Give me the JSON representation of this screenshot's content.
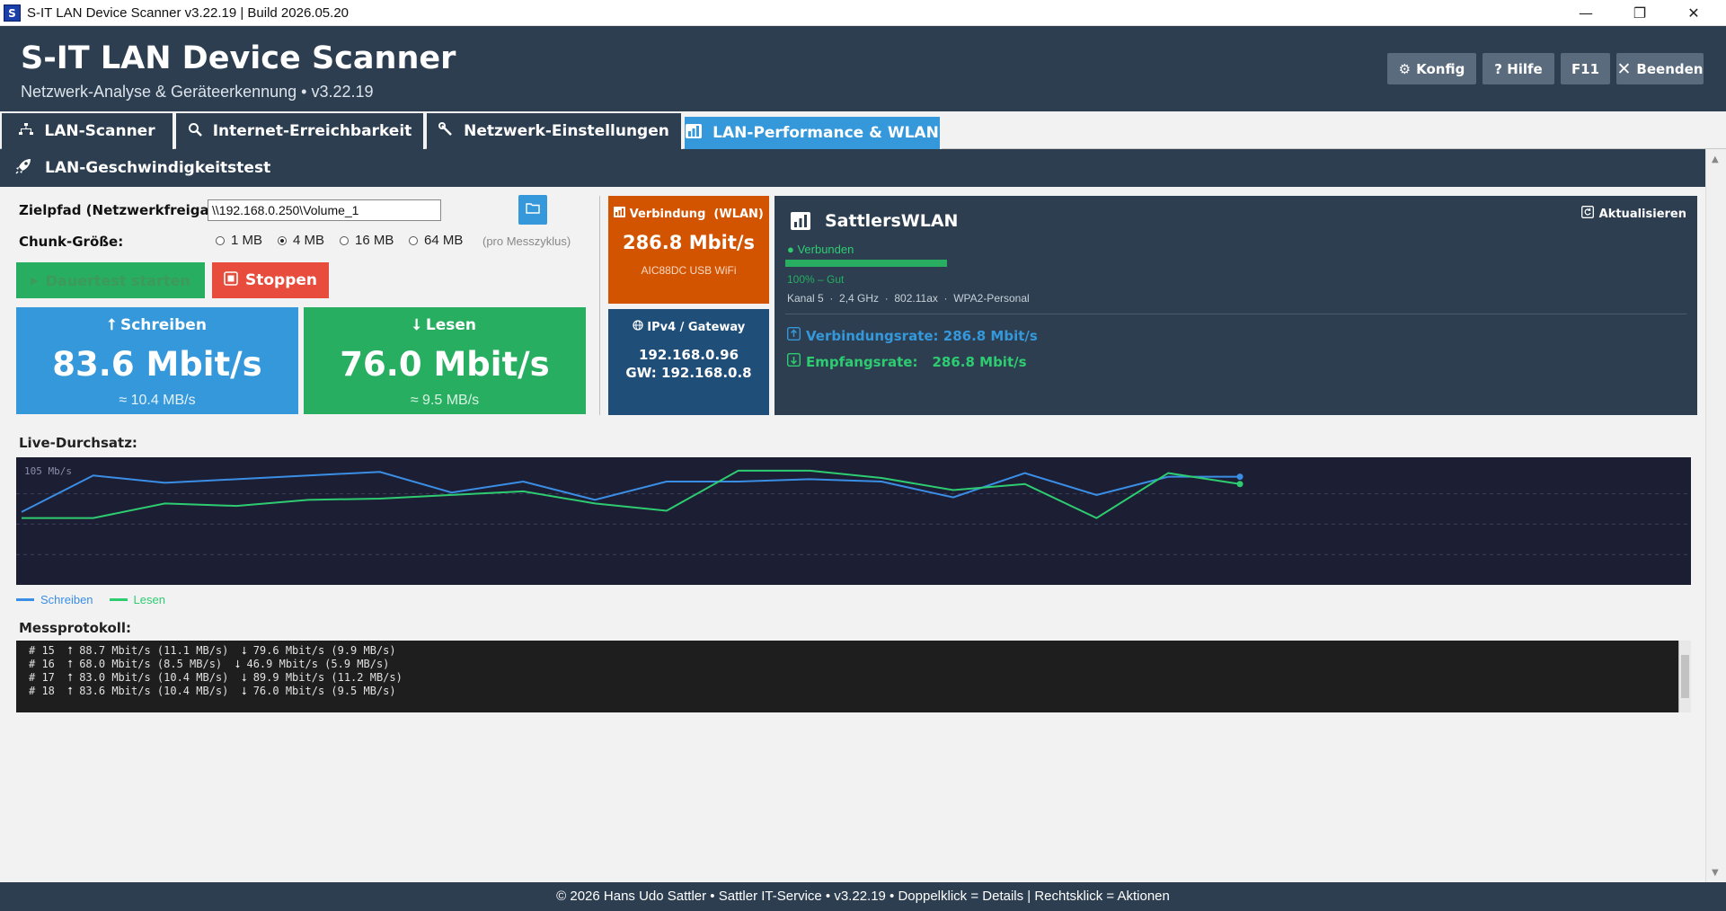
{
  "window": {
    "title": "S-IT LAN Device Scanner v3.22.19 | Build 2026.05.20",
    "icon_text": "S",
    "minimize": "—",
    "maximize": "❐",
    "close": "✕"
  },
  "header": {
    "title": "S-IT LAN Device Scanner",
    "subtitle": "Netzwerk-Analyse & Geräteerkennung  •  v3.22.19",
    "buttons": {
      "config": "Konfig",
      "help": "? Hilfe",
      "f11": "F11",
      "quit": "Beenden"
    }
  },
  "tabs": [
    {
      "label": "LAN-Scanner",
      "icon": "network-icon"
    },
    {
      "label": "Internet-Erreichbarkeit",
      "icon": "search-icon"
    },
    {
      "label": "Netzwerk-Einstellungen",
      "icon": "wrench-icon"
    },
    {
      "label": "LAN-Performance & WLAN",
      "icon": "chart-icon",
      "active": true
    }
  ],
  "section": {
    "title": "LAN-Geschwindigkeitstest",
    "icon": "rocket-icon"
  },
  "form": {
    "path_label": "Zielpfad (Netzwerkfreigabe):",
    "path_value": "\\\\192.168.0.250\\Volume_1",
    "chunk_label": "Chunk-Größe:",
    "chunk_options": [
      "1 MB",
      "4 MB",
      "16 MB",
      "64 MB"
    ],
    "chunk_selected": "4 MB",
    "chunk_hint": "(pro Messzyklus)",
    "start_label": "Dauertest starten",
    "stop_label": "Stoppen"
  },
  "write": {
    "label": "Schreiben",
    "value": "83.6 Mbit/s",
    "sub": "≈ 10.4 MB/s",
    "color": "#3498db"
  },
  "read": {
    "label": "Lesen",
    "value": "76.0 Mbit/s",
    "sub": "≈ 9.5 MB/s",
    "color": "#27ae60"
  },
  "connection": {
    "label": "Verbindung  (WLAN)",
    "value": "286.8 Mbit/s",
    "adapter": "AIC88DC USB WiFi"
  },
  "ip": {
    "label": "IPv4 / Gateway",
    "ip": "192.168.0.96",
    "gateway": "GW: 192.168.0.8"
  },
  "wlan": {
    "ssid": "SattlersWLAN",
    "refresh": "Aktualisieren",
    "status": "● Verbunden",
    "signal_percent": 100,
    "quality": "100%  –  Gut",
    "details": "Kanal 5  ·  2,4 GHz  ·  802.11ax  ·  WPA2-Personal",
    "link_rate_label": "Verbindungsrate: 286.8 Mbit/s",
    "rx_rate_label": "Empfangsrate:",
    "rx_rate_value": "286.8 Mbit/s",
    "accent_blue": "#3498db",
    "accent_green": "#2ecc71"
  },
  "chart_label": "Live-Durchsatz:",
  "chart_data": {
    "type": "line",
    "title": "",
    "xlabel": "",
    "ylabel": "105 Mb/s",
    "ylim": [
      0,
      105
    ],
    "grid": true,
    "x": [
      1,
      2,
      3,
      4,
      5,
      6,
      7,
      8,
      9,
      10,
      11,
      12,
      13,
      14,
      15,
      16,
      17,
      18
    ],
    "series": [
      {
        "name": "Schreiben",
        "color": "#3a8ee6",
        "values": [
          60,
          90,
          84,
          87,
          90,
          93,
          76,
          85,
          70,
          85,
          85,
          87,
          85,
          72,
          92,
          74,
          89,
          89
        ]
      },
      {
        "name": "Lesen",
        "color": "#2ecc71",
        "values": [
          55,
          55,
          67,
          65,
          70,
          71,
          74,
          77,
          67,
          61,
          94,
          94,
          88,
          78,
          83,
          55,
          92,
          83
        ]
      }
    ],
    "legend": "bottom-left"
  },
  "log_label": "Messprotokoll:",
  "log": [
    "# 15  ⭡ 88.7 Mbit/s (11.1 MB/s)  ⭣ 79.6 Mbit/s (9.9 MB/s)",
    "# 16  ⭡ 68.0 Mbit/s (8.5 MB/s)  ⭣ 46.9 Mbit/s (5.9 MB/s)",
    "# 17  ⭡ 83.0 Mbit/s (10.4 MB/s)  ⭣ 89.9 Mbit/s (11.2 MB/s)",
    "# 18  ⭡ 83.6 Mbit/s (10.4 MB/s)  ⭣ 76.0 Mbit/s (9.5 MB/s)"
  ],
  "footer": "© 2026 Hans Udo Sattler  •  Sattler IT-Service  •  v3.22.19  •  Doppelklick = Details   |   Rechtsklick = Aktionen"
}
